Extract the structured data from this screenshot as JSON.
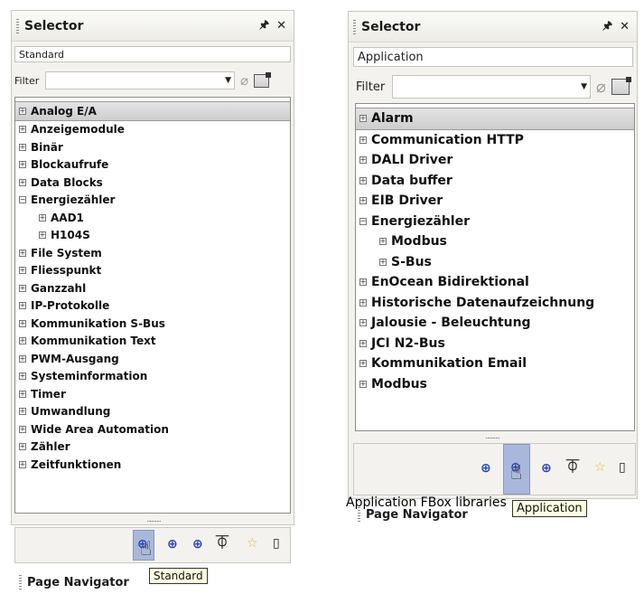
{
  "left_panel": {
    "title": "Selector",
    "pin_icon": "pin-icon",
    "close_icon": "close-icon",
    "section": "Standard",
    "filter_label": "Filter",
    "filter_value": "",
    "tree": [
      {
        "label": "Analog E/A",
        "expander": "+",
        "level": 0,
        "selected": true
      },
      {
        "label": "Anzeigemodule",
        "expander": "+",
        "level": 0
      },
      {
        "label": "Binär",
        "expander": "+",
        "level": 0
      },
      {
        "label": "Blockaufrufe",
        "expander": "+",
        "level": 0
      },
      {
        "label": "Data Blocks",
        "expander": "+",
        "level": 0
      },
      {
        "label": "Energiezähler",
        "expander": "−",
        "level": 0
      },
      {
        "label": "AAD1",
        "expander": "+",
        "level": 1
      },
      {
        "label": "H104S",
        "expander": "+",
        "level": 1
      },
      {
        "label": "File System",
        "expander": "+",
        "level": 0
      },
      {
        "label": "Fliesspunkt",
        "expander": "+",
        "level": 0
      },
      {
        "label": "Ganzzahl",
        "expander": "+",
        "level": 0
      },
      {
        "label": "IP-Protokolle",
        "expander": "+",
        "level": 0
      },
      {
        "label": "Kommunikation S-Bus",
        "expander": "+",
        "level": 0
      },
      {
        "label": "Kommunikation Text",
        "expander": "+",
        "level": 0
      },
      {
        "label": "PWM-Ausgang",
        "expander": "+",
        "level": 0
      },
      {
        "label": "Systeminformation",
        "expander": "+",
        "level": 0
      },
      {
        "label": "Timer",
        "expander": "+",
        "level": 0
      },
      {
        "label": "Umwandlung",
        "expander": "+",
        "level": 0
      },
      {
        "label": "Wide Area Automation",
        "expander": "+",
        "level": 0
      },
      {
        "label": "Zähler",
        "expander": "+",
        "level": 0
      },
      {
        "label": "Zeitfunktionen",
        "expander": "+",
        "level": 0
      }
    ],
    "resize_dots": "..........",
    "tooltip": "Standard",
    "page_navigator": "Page Navigator"
  },
  "right_panel": {
    "title": "Selector",
    "pin_icon": "pin-icon",
    "close_icon": "close-icon",
    "section": "Application",
    "filter_label": "Filter",
    "filter_value": "",
    "tree": [
      {
        "label": "Alarm",
        "expander": "+",
        "level": 0,
        "selected": true
      },
      {
        "label": "Communication HTTP",
        "expander": "+",
        "level": 0
      },
      {
        "label": "DALI Driver",
        "expander": "+",
        "level": 0
      },
      {
        "label": "Data buffer",
        "expander": "+",
        "level": 0
      },
      {
        "label": "EIB Driver",
        "expander": "+",
        "level": 0
      },
      {
        "label": "Energiezähler",
        "expander": "−",
        "level": 0
      },
      {
        "label": "Modbus",
        "expander": "+",
        "level": 1
      },
      {
        "label": "S-Bus",
        "expander": "+",
        "level": 1
      },
      {
        "label": "EnOcean Bidirektional",
        "expander": "+",
        "level": 0
      },
      {
        "label": "Historische Datenaufzeichnung",
        "expander": "+",
        "level": 0
      },
      {
        "label": "Jalousie - Beleuchtung",
        "expander": "+",
        "level": 0
      },
      {
        "label": "JCI N2-Bus",
        "expander": "+",
        "level": 0
      },
      {
        "label": "Kommunikation Email",
        "expander": "+",
        "level": 0
      },
      {
        "label": "Modbus",
        "expander": "+",
        "level": 0
      }
    ],
    "resize_dots": "..........",
    "tooltip": "Application",
    "caption": "Application FBox libraries",
    "page_navigator": "Page Navigator"
  },
  "toolbar_icons": [
    "standard-library-icon",
    "application-library-icon",
    "user-library-icon",
    "fbox-icon",
    "favorites-star-icon",
    "panel-icon"
  ],
  "colors": {
    "selected_button": "#a9b8da",
    "icon_blue": "#2442b8",
    "tooltip_bg": "#ffffe1",
    "star": "#e6b822"
  }
}
